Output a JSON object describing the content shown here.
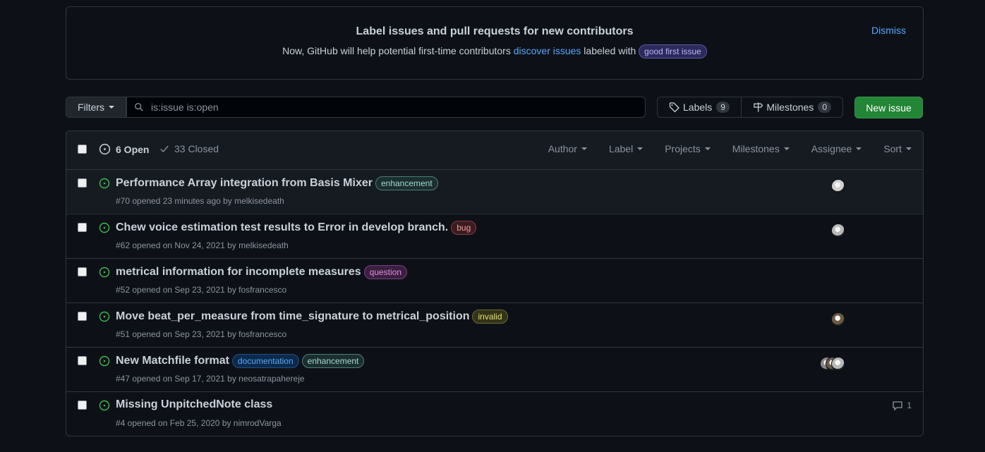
{
  "banner": {
    "title": "Label issues and pull requests for new contributors",
    "text_before": "Now, GitHub will help potential first-time contributors ",
    "link": "discover issues",
    "text_after": " labeled with ",
    "label": "good first issue",
    "dismiss": "Dismiss"
  },
  "toolbar": {
    "filters_label": "Filters",
    "search_value": "is:issue is:open",
    "labels_label": "Labels",
    "labels_count": "9",
    "milestones_label": "Milestones",
    "milestones_count": "0",
    "new_issue_label": "New issue"
  },
  "list_header": {
    "open_label": "6 Open",
    "closed_label": "33 Closed",
    "filters": [
      "Author",
      "Label",
      "Projects",
      "Milestones",
      "Assignee",
      "Sort"
    ]
  },
  "issues": [
    {
      "title": "Performance Array integration from Basis Mixer",
      "labels": [
        {
          "name": "enhancement",
          "bg": "#1b2f2f",
          "fg": "#a5d6d1",
          "border": "#4e7c7a"
        }
      ],
      "meta": "#70 opened 23 minutes ago by melkisedeath",
      "avatars": [
        "#d0d0d0"
      ],
      "comments": null
    },
    {
      "title": "Chew voice estimation test results to Error in develop branch.",
      "labels": [
        {
          "name": "bug",
          "bg": "#3a1c1f",
          "fg": "#f49b9b",
          "border": "#8a3a40"
        }
      ],
      "meta": "#62 opened on Nov 24, 2021 by melkisedeath",
      "avatars": [
        "#b8b8b8"
      ],
      "comments": null
    },
    {
      "title": "metrical information for incomplete measures",
      "labels": [
        {
          "name": "question",
          "bg": "#3a1f3f",
          "fg": "#d98fe0",
          "border": "#7a3f82"
        }
      ],
      "meta": "#52 opened on Sep 23, 2021 by fosfrancesco",
      "avatars": [],
      "comments": null
    },
    {
      "title": "Move beat_per_measure from time_signature to metrical_position",
      "labels": [
        {
          "name": "invalid",
          "bg": "#33331a",
          "fg": "#e4e669",
          "border": "#6b6b2f"
        }
      ],
      "meta": "#51 opened on Sep 23, 2021 by fosfrancesco",
      "avatars": [
        "#6b5a44"
      ],
      "comments": null
    },
    {
      "title": "New Matchfile format",
      "labels": [
        {
          "name": "documentation",
          "bg": "#0d2a4a",
          "fg": "#58a6ff",
          "border": "#1f4f8a"
        },
        {
          "name": "enhancement",
          "bg": "#1b2f2f",
          "fg": "#a5d6d1",
          "border": "#4e7c7a"
        }
      ],
      "meta": "#47 opened on Sep 17, 2021 by neosatrapahereje",
      "avatars": [
        "#8a8a8a",
        "#6b5a44",
        "#b8b8b8"
      ],
      "comments": null
    },
    {
      "title": "Missing UnpitchedNote class",
      "labels": [],
      "meta": "#4 opened on Feb 25, 2020 by nimrodVarga",
      "avatars": [],
      "comments": "1"
    }
  ],
  "colors": {
    "open_icon": "#3fb950",
    "accent": "#58a6ff",
    "primary_button": "#238636"
  }
}
